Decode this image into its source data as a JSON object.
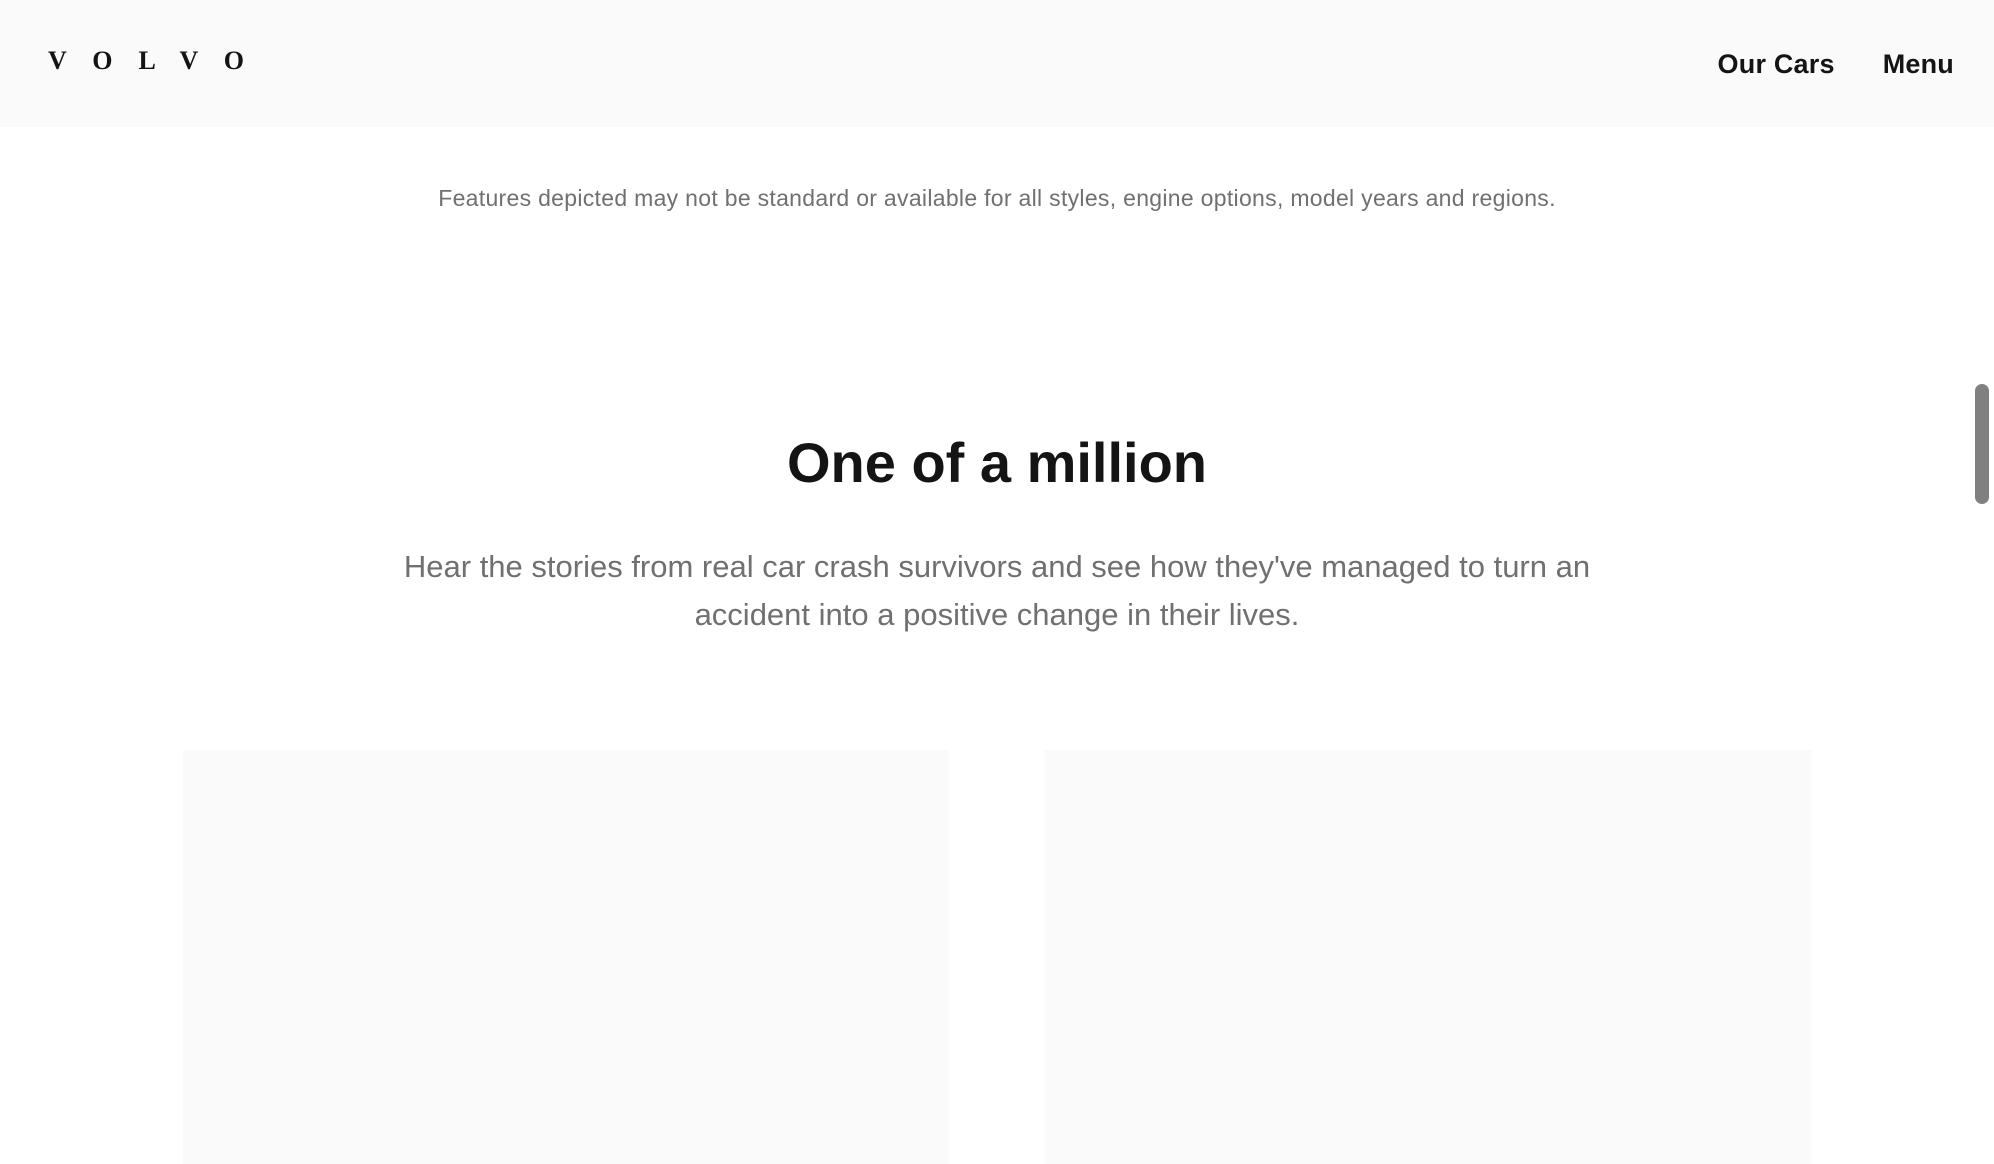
{
  "header": {
    "logo_text": "VOLVO",
    "nav": [
      {
        "label": "Our Cars"
      },
      {
        "label": "Menu"
      }
    ]
  },
  "disclaimer": "Features depicted may not be standard or available for all styles, engine options, model years and regions.",
  "section": {
    "title": "One of a million",
    "intro": "Hear the stories from real car crash survivors and see how they've managed to turn an accident into a positive change in their lives."
  },
  "colors": {
    "header_bg": "#fafafa",
    "text_dark": "#141414",
    "text_muted": "#707070",
    "card_placeholder": "#fafafa",
    "scrollbar": "#808080"
  }
}
